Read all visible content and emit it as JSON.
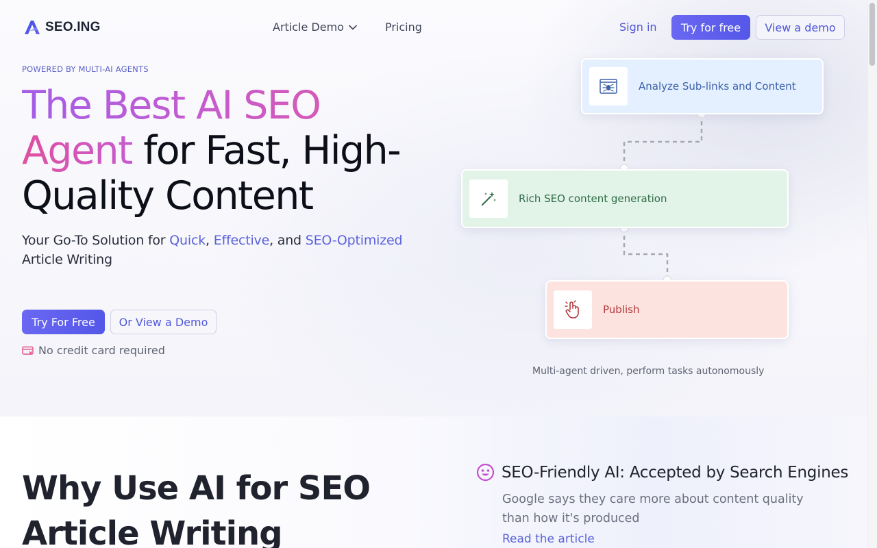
{
  "nav": {
    "logo_text": "SEO.ING",
    "links": [
      {
        "label": "Article Demo"
      },
      {
        "label": "Pricing"
      }
    ],
    "sign_in": "Sign in",
    "try_free": "Try for free",
    "view_demo": "View a demo"
  },
  "hero": {
    "eyebrow": "POWERED BY MULTI-AI AGENTS",
    "headline": {
      "grad_1": "The Best AI SEO",
      "grad_2": "Agent",
      "rest_1": " for Fast, High-",
      "rest_2": "Quality Content"
    },
    "subtitle": {
      "prefix": "Your Go-To Solution for ",
      "quick": "Quick",
      "comma": ", ",
      "effective": "Effective",
      "and": ", and ",
      "seo_optimized": "SEO-Optimized",
      "suffix": "Article Writing"
    },
    "try_button": "Try For Free",
    "demo_button": "Or View a Demo",
    "no_card": "No credit card required"
  },
  "flow": {
    "steps": [
      {
        "label": "Analyze Sub-links and Content",
        "icon": "spider-web-icon",
        "color": "#e4efff"
      },
      {
        "label": "Rich SEO content generation",
        "icon": "magic-wand-icon",
        "color": "#e2f3e8"
      },
      {
        "label": "Publish",
        "icon": "hand-pointer-icon",
        "color": "#fde3df"
      }
    ],
    "caption": "Multi-agent driven, perform tasks autonomously"
  },
  "why": {
    "title": "Why Use AI for SEO Article Writing"
  },
  "feature": {
    "icon": "smile-icon",
    "title": "SEO-Friendly AI: Accepted by Search Engines",
    "description": "Google says they care more about content quality than how it's produced",
    "link": "Read the article"
  },
  "colors": {
    "accent": "#5457e8",
    "gradient_start": "#a45de6",
    "gradient_end": "#e04f9f"
  }
}
